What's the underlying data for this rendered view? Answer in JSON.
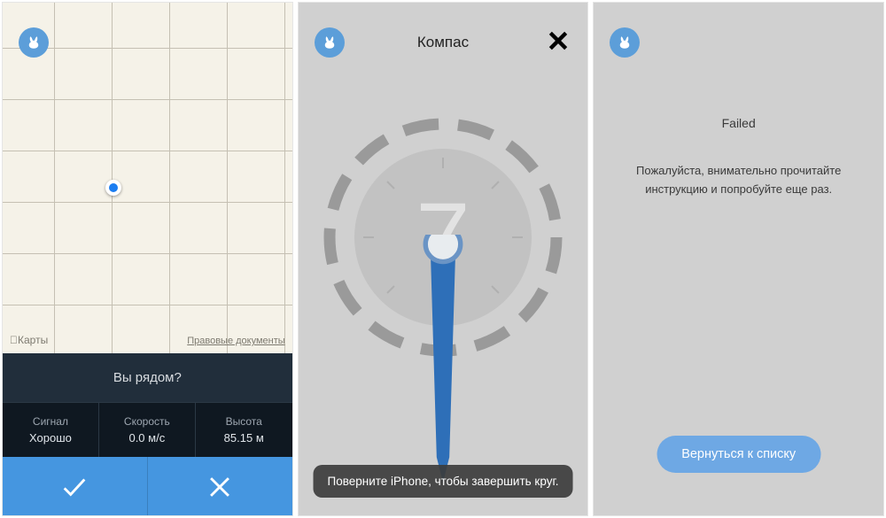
{
  "colors": {
    "accent": "#4596e0",
    "menuBtn": "#5c9ed9",
    "dark1": "#212e3b",
    "dark2": "#0f1821"
  },
  "screen1": {
    "map_label": "Карты",
    "legal_link": "Правовые документы",
    "prompt": "Вы рядом?",
    "stats": [
      {
        "label": "Сигнал",
        "value": "Хорошо"
      },
      {
        "label": "Скорость",
        "value": "0.0 м/с"
      },
      {
        "label": "Высота",
        "value": "85.15 м"
      }
    ],
    "actions": {
      "accept": "check",
      "reject": "cross"
    }
  },
  "screen2": {
    "title": "Компас",
    "instruction": "Поверните iPhone, чтобы завершить круг.",
    "countdown": "7"
  },
  "screen3": {
    "status": "Failed",
    "message": "Пожалуйста, внимательно прочитайте инструкцию и попробуйте еще раз.",
    "button": "Вернуться к списку"
  }
}
